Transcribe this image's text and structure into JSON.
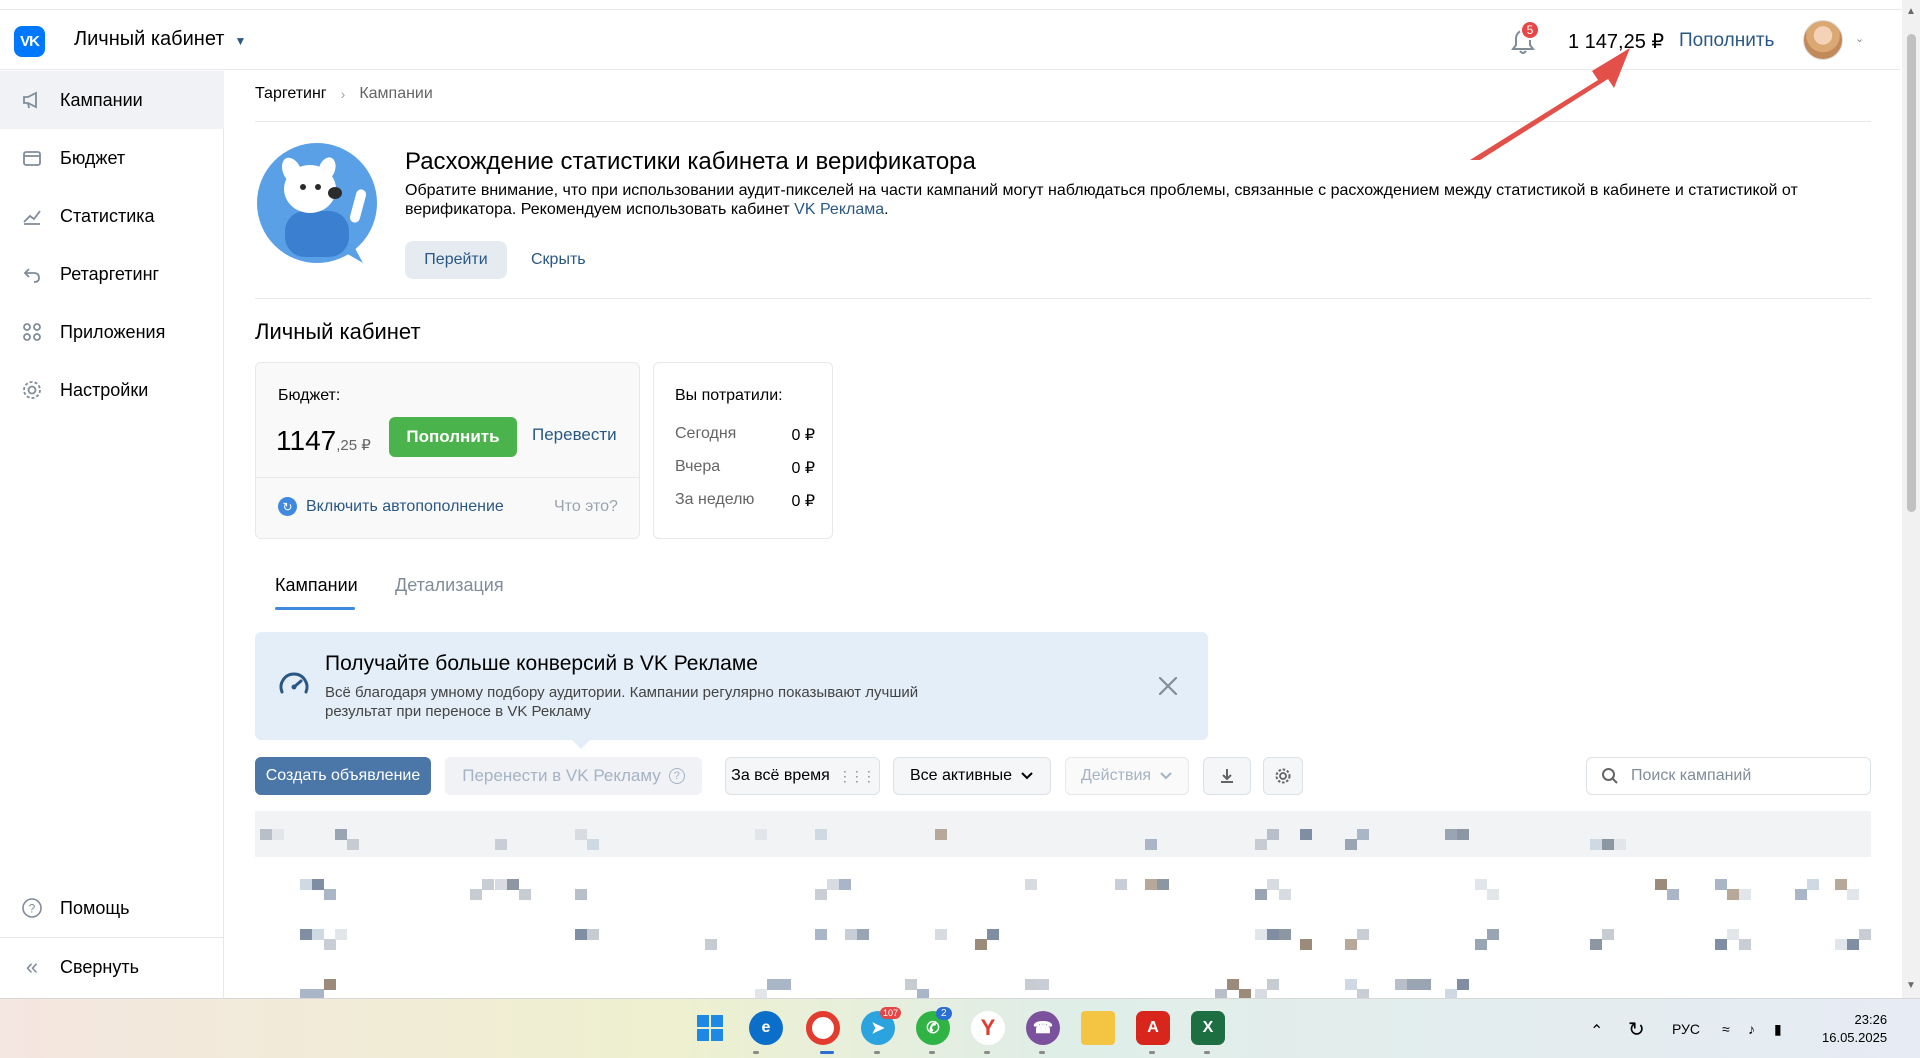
{
  "header": {
    "title": "Личный кабинет",
    "notifications_count": "5",
    "balance": "1 147,25 ₽",
    "topup_label": "Пополнить"
  },
  "sidebar": {
    "items": [
      {
        "label": "Кампании",
        "icon": "megaphone-icon",
        "active": true
      },
      {
        "label": "Бюджет",
        "icon": "wallet-icon"
      },
      {
        "label": "Статистика",
        "icon": "chart-icon"
      },
      {
        "label": "Ретаргетинг",
        "icon": "retarget-icon"
      },
      {
        "label": "Приложения",
        "icon": "apps-icon"
      },
      {
        "label": "Настройки",
        "icon": "gear-icon"
      }
    ],
    "help_label": "Помощь",
    "collapse_label": "Свернуть"
  },
  "breadcrumb": {
    "root": "Таргетинг",
    "current": "Кампании"
  },
  "promo": {
    "title": "Расхождение статистики кабинета и верификатора",
    "text_before_link": "Обратите внимание, что при использовании аудит-пикселей на части кампаний могут наблюдаться проблемы, связанные с расхождением между статистикой в кабинете и статистикой от верификатора. Рекомендуем использовать кабинет ",
    "link_text": "VK Реклама",
    "text_after_link": ".",
    "go_label": "Перейти",
    "hide_label": "Скрыть"
  },
  "section_title": "Личный кабинет",
  "budget": {
    "label": "Бюджет:",
    "amount_main": "1147",
    "amount_fraction": ",25 ₽",
    "topup_label": "Пополнить",
    "transfer_label": "Перевести",
    "autopay_label": "Включить автопополнение",
    "whatis_label": "Что это?"
  },
  "spent": {
    "title": "Вы потратили:",
    "rows": [
      {
        "label": "Сегодня",
        "value": "0 ₽"
      },
      {
        "label": "Вчера",
        "value": "0 ₽"
      },
      {
        "label": "За неделю",
        "value": "0 ₽"
      }
    ]
  },
  "tabs": [
    {
      "label": "Кампании",
      "active": true
    },
    {
      "label": "Детализация",
      "active": false
    }
  ],
  "banner": {
    "title": "Получайте больше конверсий в VK Рекламе",
    "text": "Всё благодаря умному подбору аудитории. Кампании регулярно показывают лучший результат при переносе в VK Рекламу"
  },
  "toolbar": {
    "create_label": "Создать объявление",
    "move_label": "Перенести в VK Рекламу",
    "period_label": "За всё время",
    "status_label": "Все активные",
    "actions_label": "Действия",
    "search_placeholder": "Поиск кампаний"
  },
  "taskbar": {
    "telegram_badge": "107",
    "whatsapp_badge": "2",
    "language": "РУС",
    "time": "23:26",
    "date": "16.05.2025"
  },
  "colors": {
    "accent": "#2a5885",
    "vk_blue": "#0077ff",
    "green": "#4bb34b",
    "annotation_arrow": "#e0413a"
  }
}
